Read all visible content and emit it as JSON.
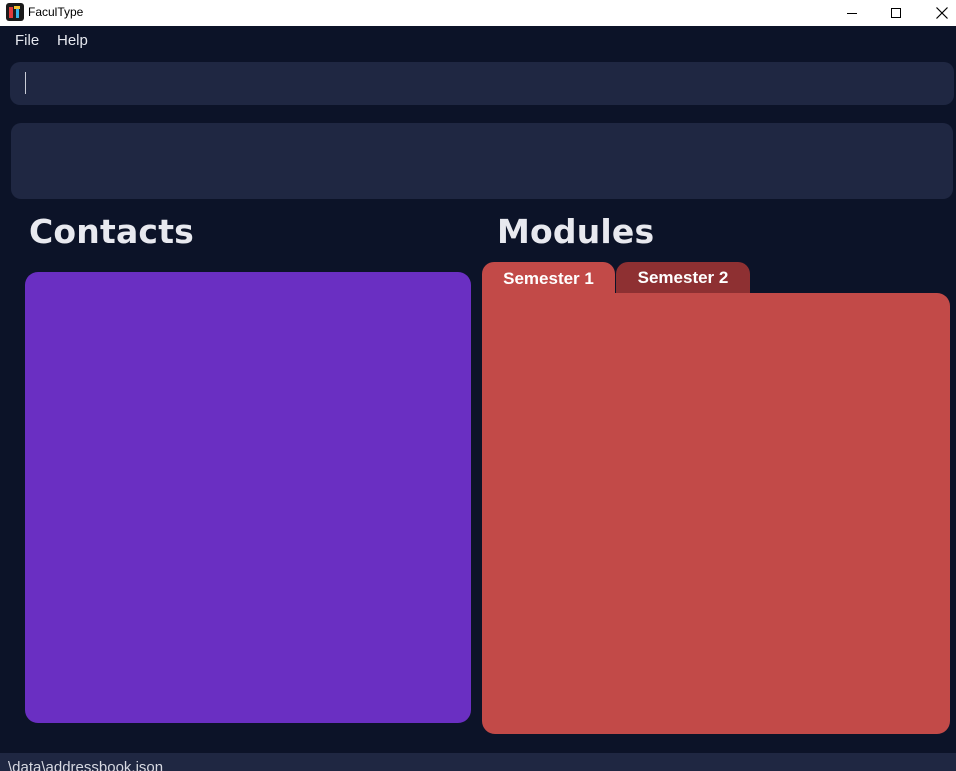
{
  "window": {
    "title": "FaculType",
    "icon": "faculype-app-icon"
  },
  "menu": {
    "file": "File",
    "help": "Help"
  },
  "command": {
    "value": "",
    "placeholder": ""
  },
  "result": {
    "text": ""
  },
  "contacts": {
    "title": "Contacts",
    "color": "#6a2fc2"
  },
  "modules": {
    "title": "Modules",
    "tabs": [
      {
        "label": "Semester 1",
        "selected": true,
        "color": "#c24a48"
      },
      {
        "label": "Semester 2",
        "selected": false,
        "color": "#8e3032"
      }
    ]
  },
  "status": {
    "path": "\\data\\addressbook.json"
  },
  "colors": {
    "background": "#0c1328",
    "box": "#1f2742",
    "contacts": "#6a2fc2",
    "modules": "#c24a48"
  }
}
